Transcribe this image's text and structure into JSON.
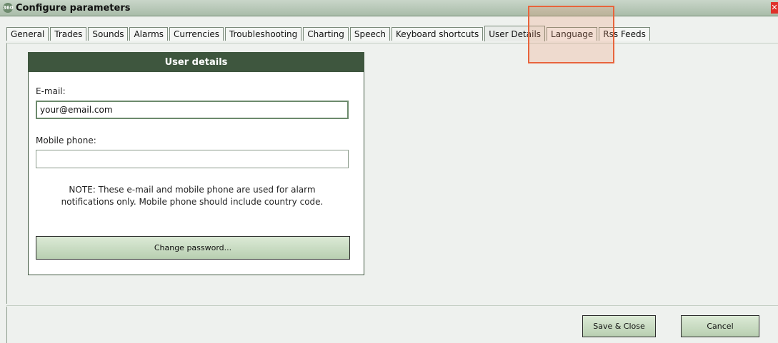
{
  "window": {
    "title": "Configure parameters",
    "icon_text": "360",
    "close_icon": "close-icon"
  },
  "tabs": [
    {
      "label": "General"
    },
    {
      "label": "Trades"
    },
    {
      "label": "Sounds"
    },
    {
      "label": "Alarms"
    },
    {
      "label": "Currencies"
    },
    {
      "label": "Troubleshooting"
    },
    {
      "label": "Charting"
    },
    {
      "label": "Speech"
    },
    {
      "label": "Keyboard shortcuts"
    },
    {
      "label": "User Details",
      "active": true
    },
    {
      "label": "Language"
    },
    {
      "label": "Rss Feeds"
    }
  ],
  "panel": {
    "title": "User details",
    "email_label": "E-mail:",
    "email_value": "your@email.com",
    "phone_label": "Mobile phone:",
    "phone_value": "",
    "note_line1": "NOTE: These e-mail and mobile phone are used for alarm",
    "note_line2": "notifications only. Mobile phone should include country code.",
    "change_password_label": "Change password..."
  },
  "footer": {
    "save_label": "Save & Close",
    "cancel_label": "Cancel"
  },
  "colors": {
    "accent": "#3e563e",
    "highlight": "#e8643c"
  }
}
